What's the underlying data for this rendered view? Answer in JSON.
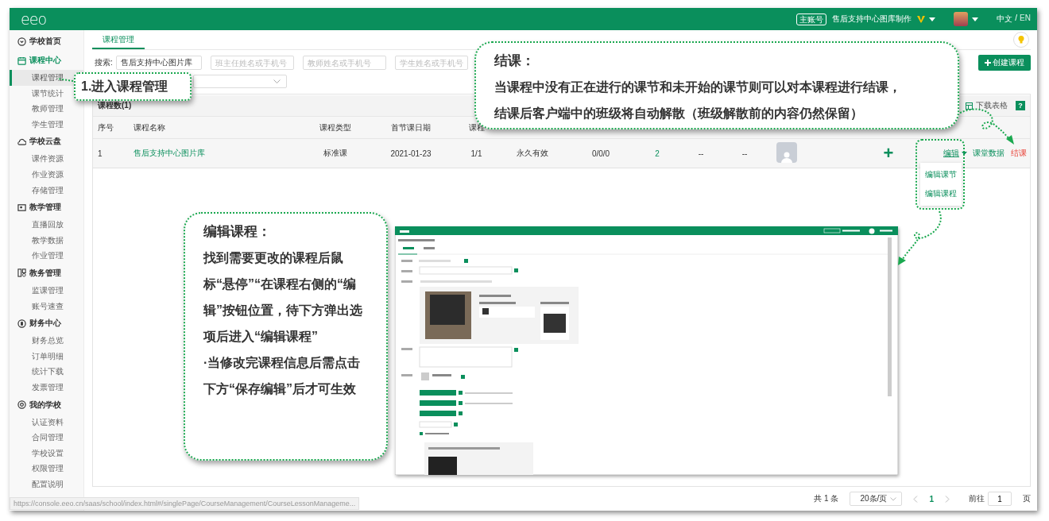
{
  "topbar": {
    "logo": "eeo",
    "account_badge": "主账号",
    "account_name": "售后支持中心图库制作",
    "languages": [
      {
        "label": "中文",
        "selected": true
      },
      {
        "label": "EN",
        "selected": false
      }
    ],
    "language_separator": "/"
  },
  "sidebar": [
    {
      "label": "学校首页"
    },
    {
      "label": "课程中心",
      "items": [
        {
          "label": "课程管理",
          "selected": true
        },
        {
          "label": "课节统计",
          "selected": false
        },
        {
          "label": "教师管理",
          "selected": false
        },
        {
          "label": "学生管理",
          "selected": false
        }
      ]
    },
    {
      "label": "学校云盘",
      "items": [
        {
          "label": "课件资源",
          "selected": false
        },
        {
          "label": "作业资源",
          "selected": false
        },
        {
          "label": "存储管理",
          "selected": false
        }
      ]
    },
    {
      "label": "教学管理",
      "items": [
        {
          "label": "直播回放",
          "selected": false
        },
        {
          "label": "教学数据",
          "selected": false
        },
        {
          "label": "作业管理",
          "selected": false
        }
      ]
    },
    {
      "label": "教务管理",
      "items": [
        {
          "label": "监课管理",
          "selected": false
        },
        {
          "label": "账号速查",
          "selected": false
        }
      ]
    },
    {
      "label": "财务中心",
      "items": [
        {
          "label": "财务总览",
          "selected": false
        },
        {
          "label": "订单明细",
          "selected": false
        },
        {
          "label": "统计下载",
          "selected": false
        },
        {
          "label": "发票管理",
          "selected": false
        }
      ]
    },
    {
      "label": "我的学校",
      "items": [
        {
          "label": "认证资料",
          "selected": false
        },
        {
          "label": "合同管理",
          "selected": false
        },
        {
          "label": "学校设置",
          "selected": false
        },
        {
          "label": "权限管理",
          "selected": false
        },
        {
          "label": "配置说明",
          "selected": false
        }
      ]
    }
  ],
  "tabs": [
    {
      "label": "课程管理",
      "selected": true
    }
  ],
  "search": {
    "label": "搜索:",
    "value": "售后支持中心图片库",
    "fields": [
      {
        "placeholder": "班主任姓名或手机号"
      },
      {
        "placeholder": "教师姓名或手机号"
      },
      {
        "placeholder": "学生姓名或手机号"
      }
    ]
  },
  "create_button": "创建课程",
  "card": {
    "title": "课程数(1)",
    "download": "下载表格",
    "help": "?"
  },
  "table": {
    "columns": [
      "序号",
      "课程名称",
      "课程类型",
      "首节课日期",
      "课程"
    ],
    "rows": [
      {
        "cells": [
          "1",
          "售后支持中心图片库",
          "标准课",
          "2021-01-23",
          "1/1",
          "永久有效",
          "0/0/0",
          "2",
          "--",
          "--"
        ],
        "add": "+",
        "actions": {
          "edit": "编辑",
          "data": "课堂数据",
          "close": "结课"
        }
      }
    ]
  },
  "edit_menu": [
    {
      "label": "编辑课节"
    },
    {
      "label": "编辑课程"
    }
  ],
  "pagination": {
    "total": "共 1 条",
    "page_size": "20条/页",
    "pages": [
      {
        "label": "1",
        "selected": true
      }
    ],
    "goto_label": "前往",
    "goto_value": "1",
    "goto_suffix": "页"
  },
  "status_url": "https://console.eeo.cn/saas/school/index.html#/singlePage/CourseManagement/CourseLessonManageme...",
  "callouts": [
    {
      "kind": "step",
      "title": "1.进入课程管理"
    },
    {
      "kind": "note",
      "title": "结课：",
      "paragraphs": [
        "当课程中没有正在进行的课节和未开始的课节则可以对本课程进行结课，",
        "结课后客户端中的班级将自动解散（班级解散前的内容仍然保留）"
      ]
    },
    {
      "kind": "note",
      "title": "编辑课程：",
      "paragraphs": [
        "找到需要更改的课程后鼠标“悬停”“在课程右侧的“编辑”按钮位置，待下方弹出选项后进入“编辑课程”",
        "·当修改完课程信息后需点击下方“保存编辑”后才可生效"
      ]
    }
  ]
}
